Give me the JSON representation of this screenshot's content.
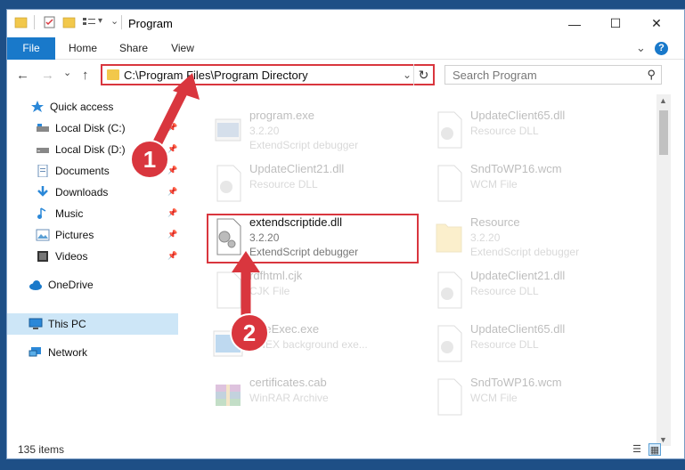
{
  "window": {
    "title": "Program",
    "minimize": "—",
    "maximize": "☐",
    "close": "✕"
  },
  "ribbon": {
    "tabs": [
      "File",
      "Home",
      "Share",
      "View"
    ],
    "expand_icon": "⌄",
    "help_icon": "?"
  },
  "navigation": {
    "back": "←",
    "forward": "→",
    "recent": "⌄",
    "up": "↑"
  },
  "address": {
    "path": "C:\\Program Files\\Program Directory",
    "chevron": "⌄",
    "refresh": "↻"
  },
  "search": {
    "placeholder": "Search Program",
    "icon": "⚲"
  },
  "sidebar": {
    "items": [
      {
        "label": "Quick access",
        "icon": "star-icon",
        "pinned": false
      },
      {
        "label": "Local Disk (C:)",
        "icon": "drive-icon",
        "pinned": true
      },
      {
        "label": "Local Disk (D:)",
        "icon": "drive-icon",
        "pinned": true
      },
      {
        "label": "Documents",
        "icon": "documents-icon",
        "pinned": true
      },
      {
        "label": "Downloads",
        "icon": "download-icon",
        "pinned": true
      },
      {
        "label": "Music",
        "icon": "music-icon",
        "pinned": true
      },
      {
        "label": "Pictures",
        "icon": "pictures-icon",
        "pinned": true
      },
      {
        "label": "Videos",
        "icon": "videos-icon",
        "pinned": true
      },
      {
        "label": "OneDrive",
        "icon": "cloud-icon",
        "pinned": false
      },
      {
        "label": "This PC",
        "icon": "computer-icon",
        "pinned": false,
        "selected": true
      },
      {
        "label": "Network",
        "icon": "network-icon",
        "pinned": false
      }
    ]
  },
  "files": [
    {
      "name": "program.exe",
      "line2": "3.2.20",
      "line3": "ExtendScript debugger",
      "icon": "exe-icon",
      "highlighted": false
    },
    {
      "name": "UpdateClient65.dll",
      "line2": "Resource DLL",
      "line3": "",
      "icon": "dll-icon",
      "highlighted": false
    },
    {
      "name": "UpdateClient21.dll",
      "line2": "Resource DLL",
      "line3": "",
      "icon": "dll-icon",
      "highlighted": false
    },
    {
      "name": "SndToWP16.wcm",
      "line2": "WCM File",
      "line3": "",
      "icon": "blank-file-icon",
      "highlighted": false
    },
    {
      "name": "extendscriptide.dll",
      "line2": "3.2.20",
      "line3": "ExtendScript debugger",
      "icon": "dll-icon",
      "highlighted": true
    },
    {
      "name": "Resource",
      "line2": "3.2.20",
      "line3": "ExtendScript debugger",
      "icon": "folder-icon",
      "highlighted": false
    },
    {
      "name": "rdfhtml.cjk",
      "line2": "CJK File",
      "line3": "",
      "icon": "blank-file-icon",
      "highlighted": false
    },
    {
      "name": "UpdateClient21.dll",
      "line2": "Resource DLL",
      "line3": "",
      "icon": "dll-icon",
      "highlighted": false
    },
    {
      "name": "OneExec.exe",
      "line2": "ONEX background exe...",
      "line3": "",
      "icon": "exe-icon",
      "highlighted": false
    },
    {
      "name": "UpdateClient65.dll",
      "line2": "Resource DLL",
      "line3": "",
      "icon": "dll-icon",
      "highlighted": false
    },
    {
      "name": "certificates.cab",
      "line2": "WinRAR Archive",
      "line3": "",
      "icon": "archive-icon",
      "highlighted": false
    },
    {
      "name": "SndToWP16.wcm",
      "line2": "WCM File",
      "line3": "",
      "icon": "blank-file-icon",
      "highlighted": false
    }
  ],
  "status": {
    "item_count": "135 items",
    "details_view_icon": "☰",
    "tiles_view_icon": "▦"
  },
  "annotations": {
    "step1": "1",
    "step2": "2",
    "color": "#d9363e"
  }
}
